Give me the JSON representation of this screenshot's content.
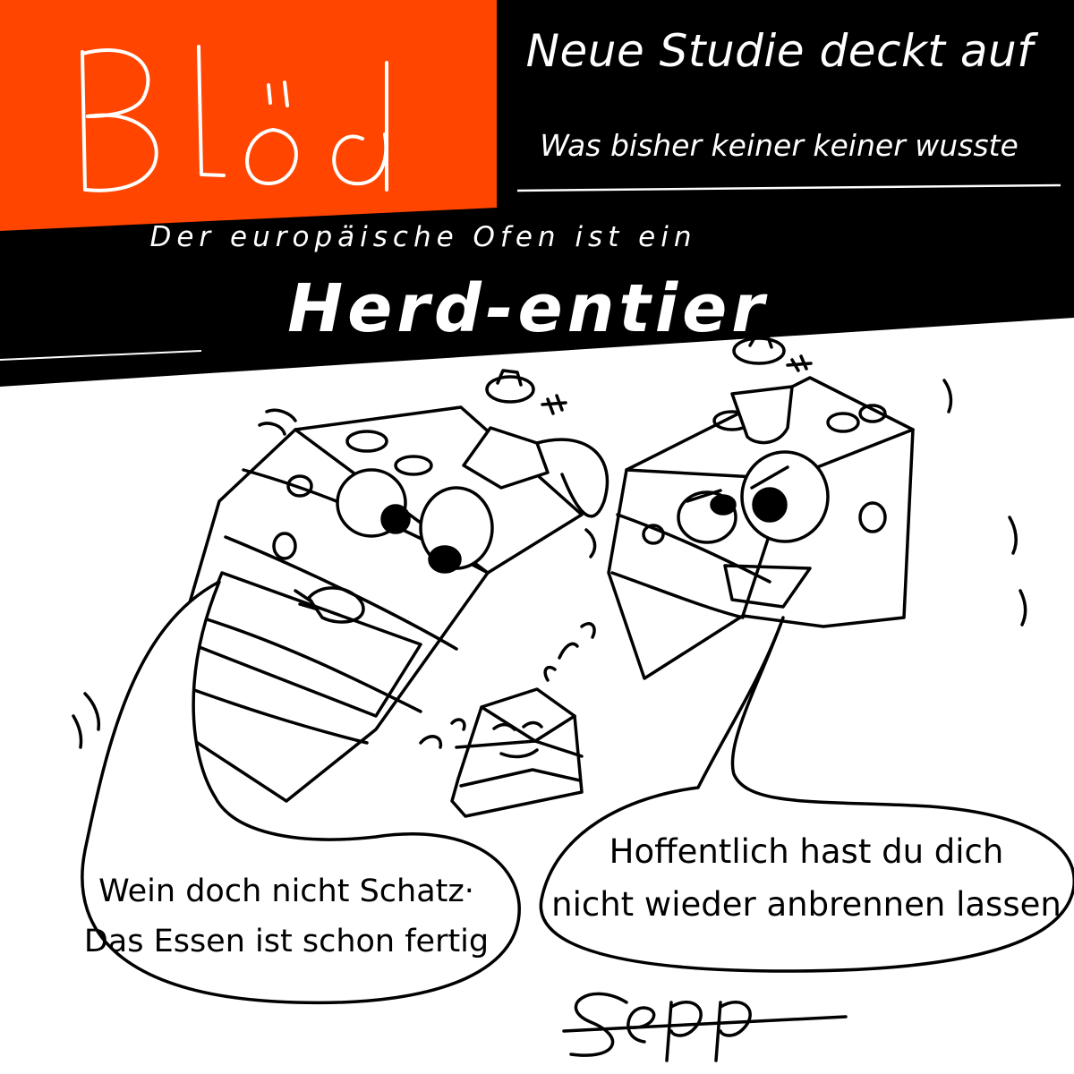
{
  "logo": {
    "text": "Blöd",
    "bg_color": "#ff4500"
  },
  "header": {
    "headline": "Neue Studie deckt auf",
    "subhead": "Was bisher keiner keiner wusste",
    "bg_color": "#000000"
  },
  "title": {
    "kicker": "Der europäische Ofen ist ein",
    "pun": "Herd-entier"
  },
  "illustration": {
    "characters": [
      "left-oven-crying",
      "right-oven-stern",
      "small-oven-child"
    ]
  },
  "bubbles": {
    "left": {
      "lines": [
        "Wein doch nicht Schatz·",
        "Das Essen ist schon fertig"
      ]
    },
    "right": {
      "lines": [
        "Hoffentlich hast du dich",
        "nicht wieder anbrennen lassen"
      ]
    }
  },
  "signature": {
    "text": "Sepp"
  }
}
